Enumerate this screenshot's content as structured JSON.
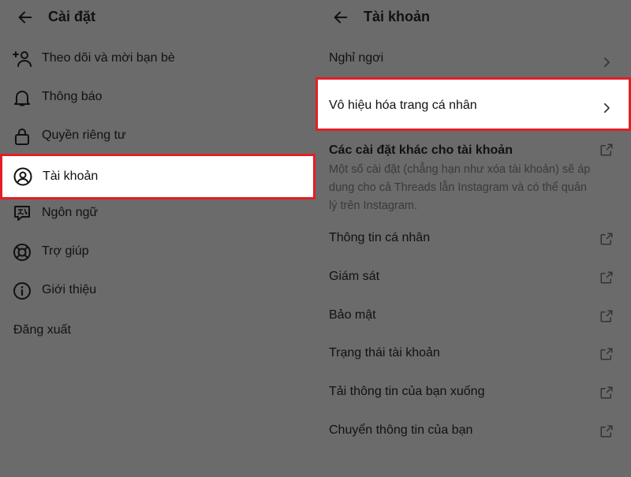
{
  "left": {
    "title": "Cài đặt",
    "items": [
      {
        "label": "Theo dõi và mời bạn bè",
        "icon": "add-person-icon"
      },
      {
        "label": "Thông báo",
        "icon": "bell-icon"
      },
      {
        "label": "Quyền riêng tư",
        "icon": "lock-icon"
      },
      {
        "label": "Tài khoản",
        "icon": "account-circle-icon",
        "highlighted": true
      },
      {
        "label": "Ngôn ngữ",
        "icon": "language-icon"
      },
      {
        "label": "Trợ giúp",
        "icon": "lifebuoy-icon"
      },
      {
        "label": "Giới thiệu",
        "icon": "info-icon"
      }
    ],
    "logout": "Đăng xuất"
  },
  "right": {
    "title": "Tài khoản",
    "items": [
      {
        "label": "Nghỉ ngơi",
        "trailing": "chevron-right-icon"
      },
      {
        "label": "Vô hiệu hóa trang cá nhân",
        "trailing": "chevron-right-icon",
        "highlighted": true
      }
    ],
    "group": {
      "title": "Các cài đặt khác cho tài khoản",
      "description": "Một số cài đặt (chẳng hạn như xóa tài khoản) sẽ áp dụng cho cả Threads lẫn Instagram và có thể quản lý trên Instagram.",
      "trailing": "external-link-icon"
    },
    "links": [
      {
        "label": "Thông tin cá nhân"
      },
      {
        "label": "Giám sát"
      },
      {
        "label": "Bảo mật"
      },
      {
        "label": "Trạng thái tài khoản"
      },
      {
        "label": "Tải thông tin của bạn xuống"
      },
      {
        "label": "Chuyển thông tin của bạn"
      }
    ]
  },
  "colors": {
    "overlay": "#6b6b6b",
    "highlight_border": "#e31e24",
    "highlight_bg": "#ffffff"
  }
}
